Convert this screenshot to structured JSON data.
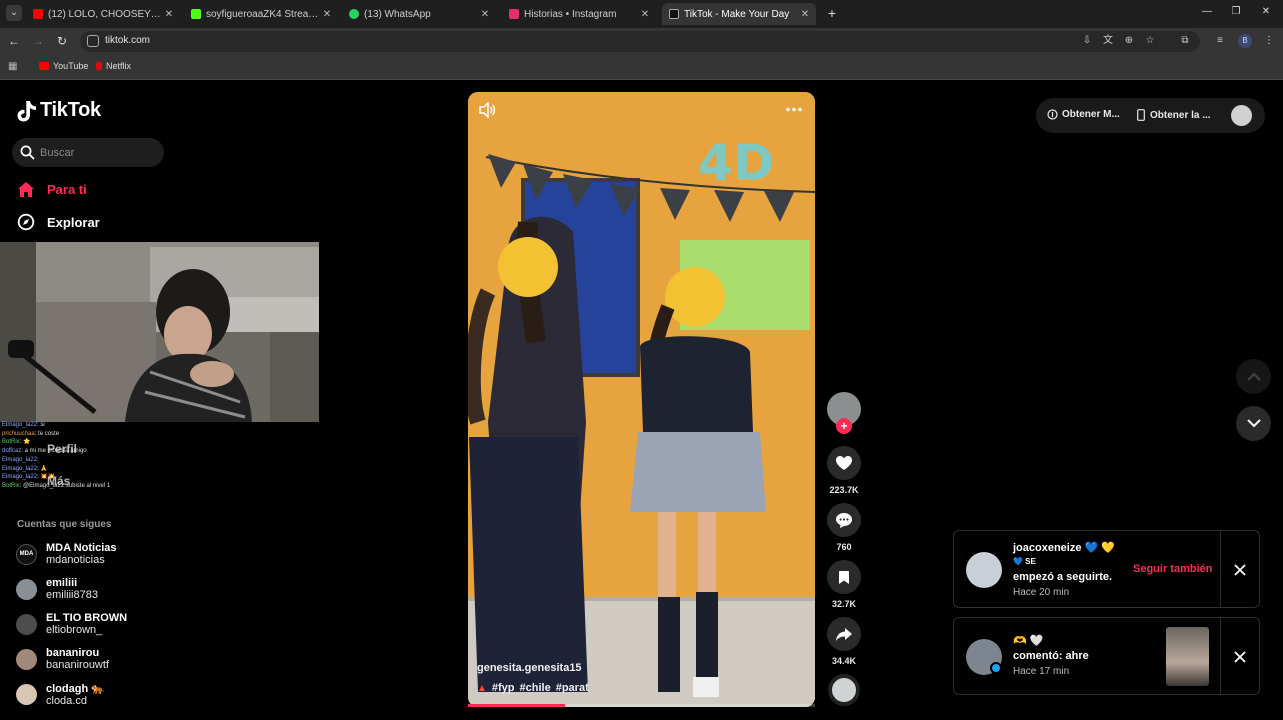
{
  "browser": {
    "tabs": [
      {
        "title": "(12) LOLO, CHOOSEY - QUÉ PU",
        "color": "#ff0000"
      },
      {
        "title": "soyfigueroaaZK4 Stream - Wate",
        "color": "#53fc18"
      },
      {
        "title": "(13) WhatsApp",
        "color": "#25d366"
      },
      {
        "title": "Historias • Instagram",
        "color": "#e1306c"
      },
      {
        "title": "TikTok - Make Your Day",
        "color": "#ffffff"
      }
    ],
    "url": "tiktok.com",
    "profile_initial": "B",
    "bookmarks": [
      {
        "label": "YouTube",
        "color": "#ff0000"
      },
      {
        "label": "Netflix",
        "color": "#e50914"
      }
    ]
  },
  "tiktok": {
    "logo": "TikTok",
    "search_placeholder": "Buscar",
    "nav": {
      "for_you": "Para ti",
      "explore": "Explorar"
    },
    "hidden_nav": {
      "profile": "Perfil",
      "more": "Más",
      "following_header": "Cuentas que sigues"
    },
    "following": [
      {
        "name": "MDA Noticias",
        "username": "mdanoticias"
      },
      {
        "name": "emiliii",
        "username": "emiliii8783"
      },
      {
        "name": "EL TIO BROWN",
        "username": "eltiobrown_"
      },
      {
        "name": "bananirou",
        "username": "bananirouwtf"
      },
      {
        "name": "clodagh 🐅",
        "username": "cloda.cd"
      }
    ],
    "chat": [
      {
        "user": "Elmago_la22",
        "msg": "si"
      },
      {
        "user": "prichuuchaa",
        "msg": "te coste"
      },
      {
        "user": "BotRix",
        "msg": "⭐"
      },
      {
        "user": "doffcaz",
        "msg": "a mi me molesta amigo"
      },
      {
        "user": "Elmago_la22",
        "msg": ""
      },
      {
        "user": "Elmago_la22",
        "msg": "🙏"
      },
      {
        "user": "Elmago_la22",
        "msg": "💥💥"
      },
      {
        "user": "BotRix",
        "msg": "@Elmago_la22 subiste al nivel 1"
      }
    ],
    "video": {
      "author": "genesita.genesita15",
      "tags": [
        "#fyp",
        "#chile",
        "#parat"
      ],
      "progress": 0.28
    },
    "actions": {
      "likes": "223.7K",
      "comments": "760",
      "saves": "32.7K",
      "shares": "34.4K"
    },
    "top_buttons": {
      "get_coins": "Obtener M...",
      "get_app": "Obtener la ..."
    },
    "notifications": [
      {
        "user": "joacoxeneize 💙 💛",
        "line2": "💙 SE",
        "text": "empezó a seguirte.",
        "time": "Hace 20 min",
        "action": "Seguir también"
      },
      {
        "user": "🫶 🤍",
        "text": "comentó: ahre",
        "time": "Hace 17 min"
      }
    ]
  }
}
